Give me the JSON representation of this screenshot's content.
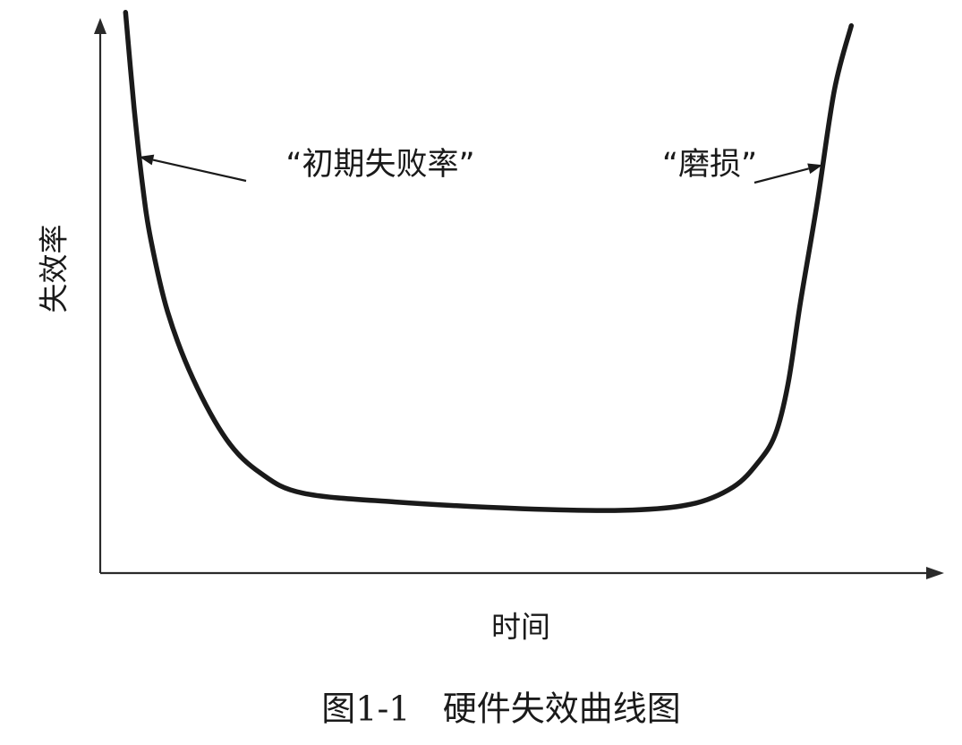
{
  "chart_data": {
    "type": "line",
    "title": "图1-1   硬件失效曲线图",
    "xlabel": "时间",
    "ylabel": "失效率",
    "xlim": [
      0,
      100
    ],
    "ylim": [
      0,
      100
    ],
    "grid": false,
    "legend": "none",
    "series": [
      {
        "x": [
          3.0,
          4.0,
          5.0,
          6.0,
          8.0,
          11.0,
          15.0,
          19.0,
          24.0,
          35.0,
          50.0,
          62.0,
          70.0,
          75.0,
          78.0,
          80.0,
          81.5,
          83.0,
          85.0,
          87.0,
          89.0
        ],
        "y": [
          101.0,
          84.0,
          70.0,
          60.0,
          47.0,
          35.0,
          24.0,
          18.0,
          14.4,
          12.8,
          11.6,
          11.3,
          12.4,
          15.5,
          20.0,
          25.0,
          34.0,
          49.0,
          67.0,
          87.0,
          98.6
        ]
      }
    ],
    "annotations": [
      {
        "text": "“初期失败率”",
        "target": [
          4.6,
          75.0
        ]
      },
      {
        "text": "“磨损”",
        "target": [
          85.6,
          73.5
        ]
      }
    ]
  },
  "colors": {
    "curve": "#1a1a1a",
    "axis": "#2a2a2a",
    "text": "#1a1a1a"
  }
}
